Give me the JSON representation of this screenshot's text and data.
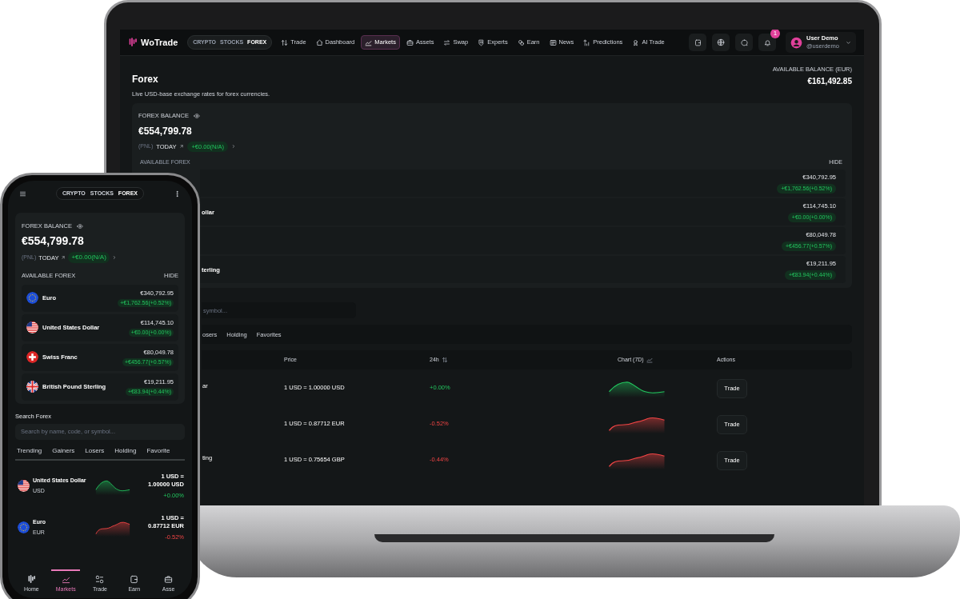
{
  "laptop": {
    "brand": "WoTrade",
    "market_switch": [
      {
        "label": "CRYPTO",
        "selected": false
      },
      {
        "label": "STOCKS",
        "selected": false
      },
      {
        "label": "FOREX",
        "selected": true
      }
    ],
    "nav": [
      {
        "label": "Trade",
        "selected": false
      },
      {
        "label": "Dashboard",
        "selected": false
      },
      {
        "label": "Markets",
        "selected": true
      },
      {
        "label": "Assets",
        "selected": false
      },
      {
        "label": "Swap",
        "selected": false
      },
      {
        "label": "Experts",
        "selected": false
      },
      {
        "label": "Earn",
        "selected": false
      },
      {
        "label": "News",
        "selected": false
      },
      {
        "label": "Predictions",
        "selected": false
      },
      {
        "label": "AI Trade",
        "selected": false
      }
    ],
    "notification_count": "1",
    "user": {
      "name": "User Demo",
      "handle": "@userdemo"
    },
    "page": {
      "title": "Forex",
      "subtitle": "Live USD-base exchange rates for forex currencies.",
      "balance_label": "AVAILABLE BALANCE (EUR)",
      "balance": "€161,492.85"
    },
    "forex_balance": {
      "label": "FOREX BALANCE",
      "amount": "€554,799.78",
      "pnl": "(PNL)",
      "period": "TODAY",
      "change": "+€0.00(N/A)"
    },
    "available": {
      "label": "AVAILABLE FOREX",
      "toggle": "HIDE",
      "rows": [
        {
          "amount": "€340,792.95",
          "change": "+€1,762.56(+0.52%)"
        },
        {
          "name": "ollar",
          "amount": "€114,745.10",
          "change": "+€0.00(+0.00%)"
        },
        {
          "amount": "€80,049.78",
          "change": "+€456.77(+0.57%)"
        },
        {
          "name": "terling",
          "amount": "€19,211.95",
          "change": "+€83.94(+0.44%)"
        }
      ]
    },
    "search": {
      "placeholder": "symbol..."
    },
    "tabs": [
      {
        "label": "osers"
      },
      {
        "label": "Holding"
      },
      {
        "label": "Favorites"
      }
    ],
    "table": {
      "columns": [
        "Price",
        "24h",
        "Chart (7D)",
        "Actions"
      ],
      "rows": [
        {
          "name": "ar",
          "price": "1 USD = 1.00000 USD",
          "change": "+0.00%",
          "kind": "up",
          "action": "Trade"
        },
        {
          "price": "1 USD = 0.87712 EUR",
          "change": "-0.52%",
          "kind": "down",
          "action": "Trade"
        },
        {
          "name": "ting",
          "price": "1 USD = 0.75654 GBP",
          "change": "-0.44%",
          "kind": "down",
          "action": "Trade"
        }
      ]
    }
  },
  "phone": {
    "market_switch": [
      {
        "label": "CRYPTO",
        "selected": false
      },
      {
        "label": "STOCKS",
        "selected": false
      },
      {
        "label": "FOREX",
        "selected": true
      }
    ],
    "forex_balance": {
      "label": "FOREX BALANCE",
      "amount": "€554,799.78",
      "pnl": "(PNL)",
      "period": "TODAY",
      "change": "+€0.00(N/A)"
    },
    "available": {
      "label": "AVAILABLE FOREX",
      "toggle": "HIDE",
      "rows": [
        {
          "kind": "eu",
          "name": "Euro",
          "amount": "€340,792.95",
          "change": "+€1,762.56(+0.52%)"
        },
        {
          "kind": "us",
          "name": "United States Dollar",
          "amount": "€114,745.10",
          "change": "+€0.00(+0.00%)"
        },
        {
          "kind": "ch",
          "name": "Swiss Franc",
          "amount": "€80,049.78",
          "change": "+€456.77(+0.57%)"
        },
        {
          "kind": "gb",
          "name": "British Pound Sterling",
          "amount": "€19,211.95",
          "change": "+€83.94(+0.44%)"
        }
      ]
    },
    "search": {
      "label": "Search Forex",
      "placeholder": "Search by name, code, or symbol..."
    },
    "tabs": [
      {
        "label": "Trending"
      },
      {
        "label": "Gainers"
      },
      {
        "label": "Losers"
      },
      {
        "label": "Holding"
      },
      {
        "label": "Favorite"
      }
    ],
    "list": [
      {
        "kind": "us",
        "name": "United States Dollar",
        "code": "USD",
        "rate": "1 USD = 1.00000 USD",
        "change": "+0.00%",
        "chart": {
          "kind": "up"
        }
      },
      {
        "kind": "eu",
        "name": "Euro",
        "code": "EUR",
        "rate": "1 USD = 0.87712 EUR",
        "change": "-0.52%",
        "chart": {
          "kind": "down"
        }
      }
    ],
    "bottom_nav": [
      {
        "label": "Home",
        "selected": false
      },
      {
        "label": "Markets",
        "selected": true
      },
      {
        "label": "Trade",
        "selected": false
      },
      {
        "label": "Earn",
        "selected": false
      },
      {
        "label": "Asse",
        "selected": false
      }
    ]
  }
}
